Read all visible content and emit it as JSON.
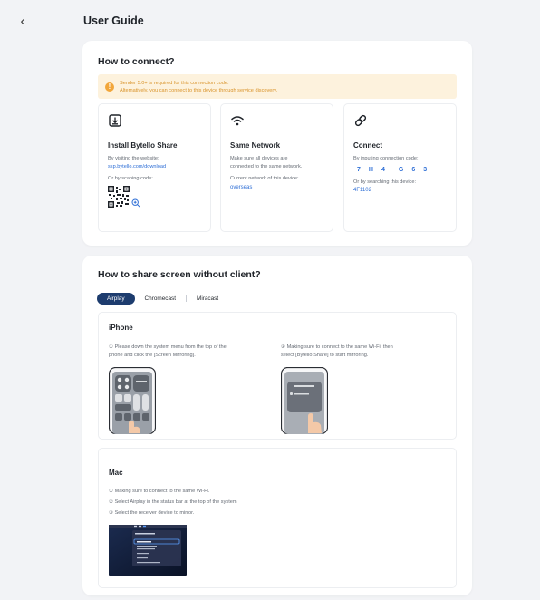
{
  "header": {
    "back_icon": "chevron-left-icon",
    "title": "User Guide"
  },
  "connect": {
    "title": "How to connect?",
    "notice": {
      "icon": "info-icon",
      "line1": "Sender 5.0+ is required for this connection code.",
      "line2": "Alternatively, you can connect to this device through service discovery."
    },
    "install": {
      "icon": "download-icon",
      "title": "Install Bytello Share",
      "text1": "By visiting the website:",
      "link": "ssp.bytello.com/download",
      "text2": "Or by scaning code:",
      "zoom_icon": "zoom-in-icon"
    },
    "network": {
      "icon": "wifi-icon",
      "title": "Same Network",
      "text1": "Make sure all devices are",
      "text2": "connected to the same network.",
      "text3": "Current network of this device:",
      "value": "overseas"
    },
    "connect_col": {
      "icon": "link-icon",
      "title": "Connect",
      "text1": "By inputing connection code:",
      "code": [
        "7",
        "H",
        "4",
        "G",
        "6",
        "3"
      ],
      "text2": "Or by searching this device:",
      "device": "4F1102"
    }
  },
  "share": {
    "title": "How to share screen without client?",
    "tabs": [
      "Airplay",
      "Chromecast",
      "Miracast"
    ],
    "iphone": {
      "title": "iPhone",
      "step1_line1": "① Please down the system menu from the top of the",
      "step1_line2": "phone and click the [Screen Mirroring].",
      "step2_line1": "② Making sure to connect to the same Wi-Fi, then",
      "step2_line2": "select [Bytello Share] to start mirroring."
    },
    "mac": {
      "title": "Mac",
      "step1": "① Making sure to connect to the same Wi-Fi.",
      "step2": "② Select Airplay in the status bar at the top of the system",
      "step3": "③ Select the receiver device to mirror."
    }
  },
  "colors": {
    "accent": "#2f6fd6",
    "tab_active": "#1d3c6e",
    "notice_bg": "#fdf2dd",
    "notice_text": "#d9932a"
  }
}
